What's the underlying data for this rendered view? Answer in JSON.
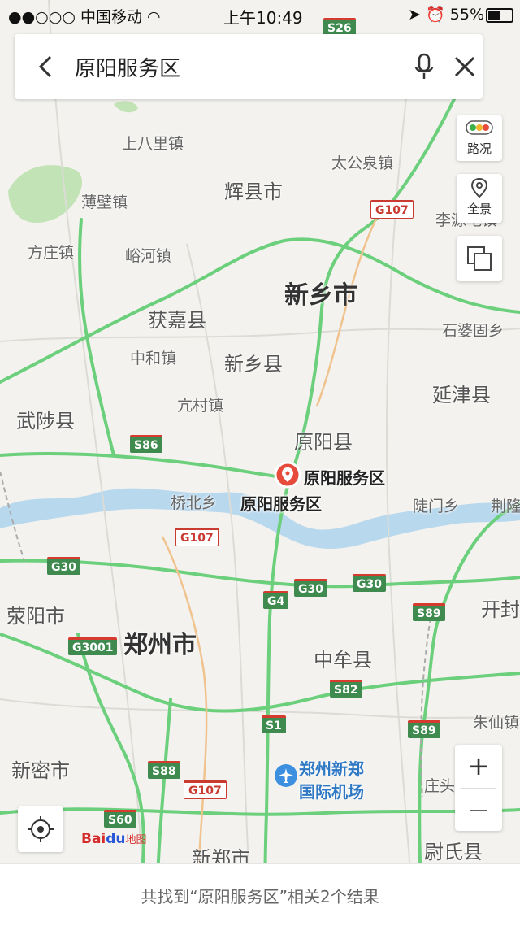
{
  "status_bar": {
    "signal": "●●○○○",
    "carrier": "中国移动",
    "time": "上午10:49",
    "battery": "55%"
  },
  "search": {
    "query": "原阳服务区"
  },
  "side_controls": {
    "traffic_label": "路况",
    "panorama_label": "全景"
  },
  "map": {
    "cities": [
      {
        "name": "新乡市"
      },
      {
        "name": "郑州市"
      }
    ],
    "counties": [
      {
        "name": "辉县市"
      },
      {
        "name": "获嘉县"
      },
      {
        "name": "新乡县"
      },
      {
        "name": "延津县"
      },
      {
        "name": "武陟县"
      },
      {
        "name": "原阳县"
      },
      {
        "name": "荥阳市"
      },
      {
        "name": "中牟县"
      },
      {
        "name": "新密市"
      },
      {
        "name": "新郑市"
      },
      {
        "name": "尉氏县"
      },
      {
        "name": "开封"
      }
    ],
    "towns": [
      {
        "name": "上八里镇"
      },
      {
        "name": "太公泉镇"
      },
      {
        "name": "薄壁镇"
      },
      {
        "name": "方庄镇"
      },
      {
        "name": "峪河镇"
      },
      {
        "name": "石婆固乡"
      },
      {
        "name": "中和镇"
      },
      {
        "name": "亢村镇"
      },
      {
        "name": "桥北乡"
      },
      {
        "name": "陡门乡"
      },
      {
        "name": "荆隆"
      },
      {
        "name": "朱仙镇"
      },
      {
        "name": "庄头"
      },
      {
        "name": "李源屯镇"
      }
    ],
    "highway_shields": [
      {
        "code": "S26"
      },
      {
        "code": "G107"
      },
      {
        "code": "S86"
      },
      {
        "code": "G107"
      },
      {
        "code": "G30"
      },
      {
        "code": "G30"
      },
      {
        "code": "G30"
      },
      {
        "code": "G4"
      },
      {
        "code": "S89"
      },
      {
        "code": "G3001"
      },
      {
        "code": "S82"
      },
      {
        "code": "S1"
      },
      {
        "code": "S89"
      },
      {
        "code": "S88"
      },
      {
        "code": "G107"
      },
      {
        "code": "S60"
      }
    ],
    "result_marker_label": "原阳服务区",
    "result_place_label": "原阳服务区",
    "airport_name_line1": "郑州新郑",
    "airport_name_line2": "国际机场",
    "logo_text": "Bai",
    "logo_paw": "du",
    "logo_map": "地图",
    "colors": {
      "river": "#b8d8ee",
      "green_area": "#bfe2b5",
      "highway": "#6bcf7c",
      "marker": "#e64b3c"
    }
  },
  "zoom": {
    "plus": "+",
    "minus": "—"
  },
  "results": {
    "summary": "共找到“原阳服务区”相关2个结果"
  }
}
